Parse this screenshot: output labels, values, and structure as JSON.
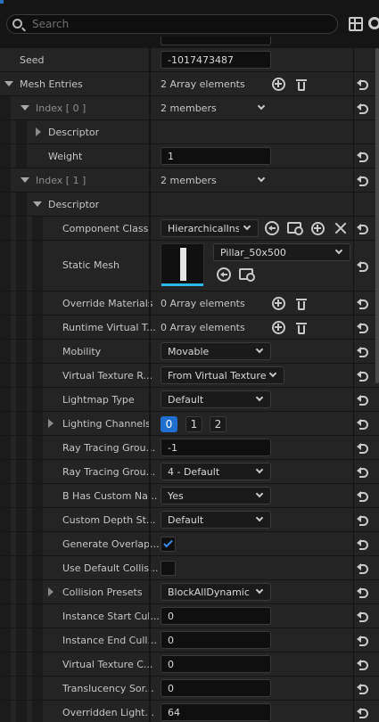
{
  "search": {
    "placeholder": "Search"
  },
  "rows": {
    "seed": {
      "label": "Seed",
      "value": "-1017473487"
    },
    "mesh_entries": {
      "label": "Mesh Entries",
      "value": "2 Array elements"
    },
    "index0": {
      "label": "Index [ 0 ]",
      "value": "2 members"
    },
    "descriptor0": {
      "label": "Descriptor"
    },
    "weight": {
      "label": "Weight",
      "value": "1"
    },
    "index1": {
      "label": "Index [ 1 ]",
      "value": "2 members"
    },
    "descriptor1": {
      "label": "Descriptor"
    },
    "component_class": {
      "label": "Component Class",
      "value": "HierarchicalIns"
    },
    "static_mesh": {
      "label": "Static Mesh",
      "value": "Pillar_50x500"
    },
    "override_materials": {
      "label": "Override Materials",
      "value": "0 Array elements"
    },
    "runtime_vt": {
      "label": "Runtime Virtual T...",
      "value": "0 Array elements"
    },
    "mobility": {
      "label": "Mobility",
      "value": "Movable"
    },
    "vt_render": {
      "label": "Virtual Texture R...",
      "value": "From Virtual Texture"
    },
    "lightmap_type": {
      "label": "Lightmap Type",
      "value": "Default"
    },
    "lighting_channels": {
      "label": "Lighting Channels",
      "chips": [
        "0",
        "1",
        "2"
      ]
    },
    "rt_group1": {
      "label": "Ray Tracing Grou...",
      "value": "-1"
    },
    "rt_group2": {
      "label": "Ray Tracing Grou...",
      "value": "4 - Default"
    },
    "b_has_custom": {
      "label": "B Has Custom Na...",
      "value": "Yes"
    },
    "custom_depth": {
      "label": "Custom Depth St...",
      "value": "Default"
    },
    "gen_overlap": {
      "label": "Generate Overlap...",
      "checked": true
    },
    "use_default_coll": {
      "label": "Use Default Collis...",
      "checked": false
    },
    "collision_presets": {
      "label": "Collision Presets",
      "value": "BlockAllDynamic"
    },
    "inst_start": {
      "label": "Instance Start Cul...",
      "value": "0"
    },
    "inst_end": {
      "label": "Instance End Cull...",
      "value": "0"
    },
    "vt_cull": {
      "label": "Virtual Texture C...",
      "value": "0"
    },
    "transl_sort": {
      "label": "Translucency Sor...",
      "value": "0"
    },
    "overridden_light": {
      "label": "Overridden Light...",
      "value": "64"
    }
  }
}
